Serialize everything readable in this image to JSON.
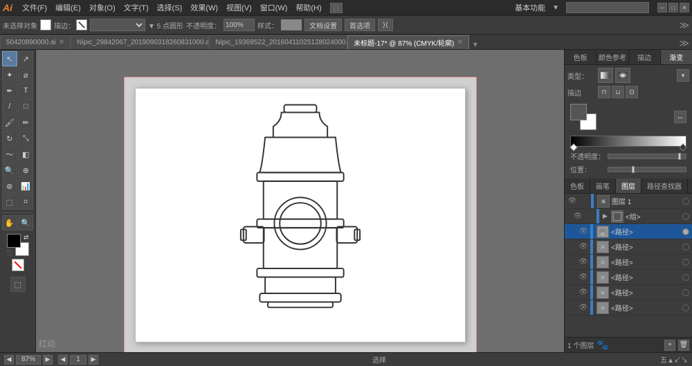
{
  "app": {
    "logo": "Ai",
    "name": "Adobe Illustrator"
  },
  "menubar": {
    "items": [
      "文件(F)",
      "编辑(E)",
      "对象(O)",
      "文字(T)",
      "选择(S)",
      "效果(W)",
      "视图(V)",
      "窗口(W)",
      "帮助(H)"
    ],
    "mode_label": "基本功能",
    "mode_arrow": "▼",
    "search_placeholder": ""
  },
  "options_bar": {
    "no_select_label": "未选择对象",
    "stroke_label": "描边：",
    "points_label": "▼ 5 点圆形",
    "opacity_label": "不透明度：",
    "opacity_value": "100%",
    "style_label": "样式：",
    "doc_settings": "文档设置",
    "first_select": "首选项",
    "extra": "⟩⟨"
  },
  "tabs": [
    {
      "label": "50420890000.ai",
      "active": false,
      "modified": false
    },
    {
      "label": "Nipic_29842067_2019090318260831000.ai",
      "active": false,
      "modified": false
    },
    {
      "label": "Nipic_19369522_20160411025128024000.ai",
      "active": false,
      "modified": false
    },
    {
      "label": "未标题-17*",
      "active": true,
      "modified": true,
      "info": "87% (CMYK/轮廓)"
    }
  ],
  "tools": [
    {
      "name": "selection-tool",
      "icon": "↖",
      "active": true
    },
    {
      "name": "direct-selection-tool",
      "icon": "↗"
    },
    {
      "name": "magic-wand-tool",
      "icon": "✦"
    },
    {
      "name": "lasso-tool",
      "icon": "⌀"
    },
    {
      "name": "pen-tool",
      "icon": "✒"
    },
    {
      "name": "type-tool",
      "icon": "T"
    },
    {
      "name": "line-tool",
      "icon": "\\"
    },
    {
      "name": "rectangle-tool",
      "icon": "□"
    },
    {
      "name": "paintbrush-tool",
      "icon": "🖌"
    },
    {
      "name": "pencil-tool",
      "icon": "✏"
    },
    {
      "name": "rotate-tool",
      "icon": "↻"
    },
    {
      "name": "scale-tool",
      "icon": "⤡"
    },
    {
      "name": "warp-tool",
      "icon": "~"
    },
    {
      "name": "gradient-tool",
      "icon": "◧"
    },
    {
      "name": "eyedropper-tool",
      "icon": "💉"
    },
    {
      "name": "blend-tool",
      "icon": "⊕"
    },
    {
      "name": "symbol-sprayer-tool",
      "icon": "✦"
    },
    {
      "name": "graph-tool",
      "icon": "📊"
    },
    {
      "name": "artboard-tool",
      "icon": "⬚"
    },
    {
      "name": "slice-tool",
      "icon": "⌗"
    },
    {
      "name": "hand-tool",
      "icon": "✋"
    },
    {
      "name": "zoom-tool",
      "icon": "🔍"
    }
  ],
  "canvas": {
    "zoom": "87%",
    "page": "1",
    "color_mode": "CMYK/轮廓"
  },
  "right_panel": {
    "tabs": [
      "色板",
      "画笔",
      "图层",
      "路径查找器"
    ],
    "active_tab": "图层",
    "gradient_tab": {
      "type_label": "类型：",
      "type_options": [
        "线性",
        "径向"
      ],
      "stroke_label": "描边",
      "opacity_label": "不透明度：",
      "position_label": "位置："
    },
    "color_panel_tabs": [
      "色板",
      "颜色参考",
      "描边",
      "渐变"
    ],
    "active_color_tab": "渐变"
  },
  "layers": {
    "title": "图层 1",
    "items": [
      {
        "name": "图层 1",
        "visible": true,
        "locked": false,
        "level": 0
      },
      {
        "name": "<组>",
        "visible": true,
        "locked": false,
        "level": 1
      },
      {
        "name": "<路径>",
        "visible": true,
        "locked": false,
        "level": 2
      },
      {
        "name": "<路径>",
        "visible": true,
        "locked": false,
        "level": 2
      },
      {
        "name": "<路径>",
        "visible": true,
        "locked": false,
        "level": 2
      },
      {
        "name": "<路径>",
        "visible": true,
        "locked": false,
        "level": 2
      },
      {
        "name": "<路径>",
        "visible": true,
        "locked": false,
        "level": 2
      },
      {
        "name": "<路径>",
        "visible": true,
        "locked": false,
        "level": 2
      }
    ],
    "footer": "1 个图层",
    "paw_icon": "🐾"
  },
  "status_bar": {
    "zoom": "87%",
    "page": "1",
    "center_label": "选择",
    "arrow_left": "◀",
    "arrow_right": "▶"
  }
}
